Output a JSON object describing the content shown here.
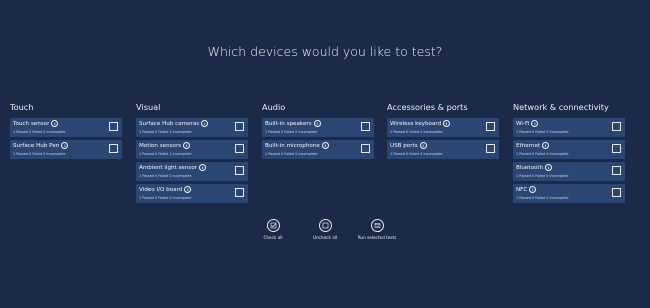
{
  "title": "Which devices would you like to test?",
  "columns": [
    {
      "heading": "Touch",
      "items": [
        {
          "name": "Touch sensor",
          "stats": "1 Passed  0 Failed  0 Incomplete"
        },
        {
          "name": "Surface Hub Pen",
          "stats": "1 Passed  0 Failed  0 Incomplete"
        }
      ]
    },
    {
      "heading": "Visual",
      "items": [
        {
          "name": "Surface Hub cameras",
          "stats": "1 Passed  0 Failed  4 Incomplete"
        },
        {
          "name": "Motion sensors",
          "stats": "1 Passed  0 Failed  1 Incomplete"
        },
        {
          "name": "Ambient light sensor",
          "stats": "1 Passed  0 Failed  0 Incomplete"
        },
        {
          "name": "Video I/O board",
          "stats": "1 Passed  0 Failed  0 Incomplete"
        }
      ]
    },
    {
      "heading": "Audio",
      "items": [
        {
          "name": "Built-in speakers",
          "stats": "1 Passed  0 Failed  0 Incomplete"
        },
        {
          "name": "Built-in microphone",
          "stats": "1 Passed  0 Failed  0 Incomplete"
        }
      ]
    },
    {
      "heading": "Accessories & ports",
      "items": [
        {
          "name": "Wireless keyboard",
          "stats": "2 Passed  0 Failed  0 Incomplete"
        },
        {
          "name": "USB ports",
          "stats": "1 Passed  0 Failed  4 Incomplete"
        }
      ]
    },
    {
      "heading": "Network & connectivity",
      "items": [
        {
          "name": "Wi-Fi",
          "stats": "1 Passed  0 Failed  0 Incomplete"
        },
        {
          "name": "Ethernet",
          "stats": "1 Passed  0 Failed  0 Incomplete"
        },
        {
          "name": "Bluetooth",
          "stats": "1 Passed  0 Failed  0 Incomplete"
        },
        {
          "name": "NFC",
          "stats": "1 Passed  0 Failed  0 Incomplete"
        }
      ]
    }
  ],
  "info_glyph": "i",
  "actions": {
    "check_all": {
      "label": "Check all",
      "icon": "check-all-icon"
    },
    "uncheck_all": {
      "label": "Uncheck all",
      "icon": "uncheck-all-icon"
    },
    "run_selected": {
      "label": "Run selected tests",
      "icon": "run-tests-icon"
    }
  },
  "colors": {
    "background": "#1b2a48",
    "card": "#2c4674",
    "text": "#ffffff"
  }
}
